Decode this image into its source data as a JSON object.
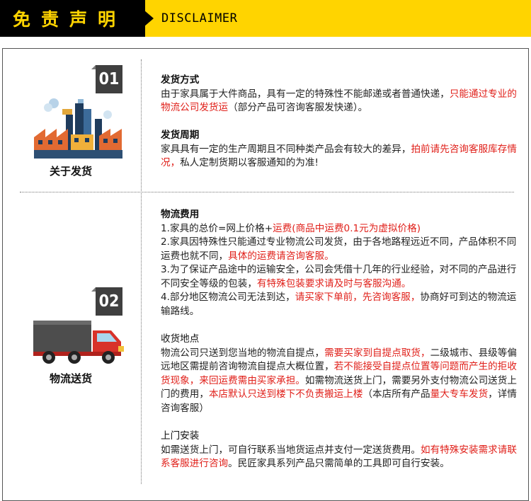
{
  "header": {
    "title": "免责声明",
    "subtitle": "DISCLAIMER",
    "colors": {
      "yellow": "#ffd400",
      "black": "#000000"
    }
  },
  "colors": {
    "highlight_red": "#e0201a",
    "text": "#222222",
    "badge": "#3f3f3f"
  },
  "blocks": [
    {
      "badge": "01",
      "icon": "factory-icon",
      "label": "关于发货",
      "sections": [
        {
          "title": "发货方式",
          "p1_normal": "由于家具属于大件商品，具有一定的特殊性不能邮递或者普通快递，",
          "p1_red": "只能通过专业的物流公司发货运",
          "p1_tail": "（部分产品可咨询客服发快递）。"
        },
        {
          "title": "发货周期",
          "p1_normal": "家具具有一定的生产周期且不同种类产品会有较大的差异，",
          "p1_red": "拍前请先咨询客服库存情况，",
          "p1_tail": "私人定制货期以客服通知的为准!"
        }
      ]
    },
    {
      "badge": "02",
      "icon": "truck-icon",
      "label": "物流送货",
      "logistics": {
        "title": "物流费用",
        "l1_normal": "1.家具的总价=网上价格+",
        "l1_red": "运费(商品中运费0.1元为虚拟价格)",
        "l2_normal": "2.家具因特殊性只能通过专业物流公司发货，由于各地路程远近不同，产品体积不同运费也就不同，",
        "l2_red": "具体的运费请咨询客服。",
        "l3_normal": "3.为了保证产品途中的运输安全，公司会凭借十几年的行业经验，对不同的产品进行不同安全等级的包装，",
        "l3_red": "有特殊包装要求请及时与客服沟通。",
        "l4_normal": "4.部分地区物流公司无法到达，",
        "l4_red": "请买家下单前，先咨询客服，",
        "l4_tail": "协商好可到达的物流运输路线。"
      },
      "pickup": {
        "title": "收货地点",
        "a": "物流公司只送到您当地的物流自提点，",
        "b_red": "需要买家到自提点取货，",
        "c": "二级城市、县级等偏远地区需提前咨询物流自提点大概位置，",
        "d_red": "若不能接受自提点位置等问题而产生的拒收货现象，来回运费需由买家承担。",
        "e": "如需物流送货上门，需要另外支付物流公司送货上门的费用，",
        "f_red": "本店默认只送到楼下不负责搬运上楼",
        "g": "（本店所有产品",
        "h_red": "量大专车发货",
        "i": "，详情咨询客服）"
      },
      "install": {
        "title": "上门安装",
        "a": "如需送货上门，可自行联系当地货运点并支付一定送货费用。",
        "b_red": "如有特殊安装需求请联系客服进行咨询",
        "c": "。民匠家具系列产品只需简单的工具即可自行安装。"
      }
    }
  ]
}
